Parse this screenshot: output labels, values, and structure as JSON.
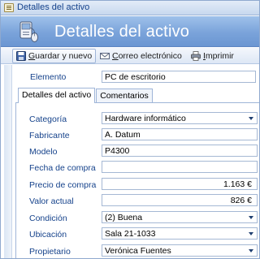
{
  "window": {
    "title": "Detalles del activo"
  },
  "header": {
    "title": "Detalles del activo",
    "icon": "computer-mouse-icon"
  },
  "toolbar": {
    "save_label": "Guardar y nuevo",
    "save_underline": "G",
    "email_label": "Correo electrónico",
    "email_underline": "C",
    "print_label": "Imprimir",
    "print_underline": "I"
  },
  "item": {
    "label": "Elemento",
    "value": "PC de escritorio"
  },
  "tabs": [
    {
      "label": "Detalles del activo",
      "active": true
    },
    {
      "label": "Comentarios",
      "active": false
    }
  ],
  "fields": {
    "categoria": {
      "label": "Categoría",
      "value": "Hardware informático"
    },
    "fabricante": {
      "label": "Fabricante",
      "value": "A. Datum"
    },
    "modelo": {
      "label": "Modelo",
      "value": "P4300"
    },
    "fecha_compra": {
      "label": "Fecha de compra",
      "value": ""
    },
    "precio_compra": {
      "label": "Precio de compra",
      "value": "1.163 €"
    },
    "valor_actual": {
      "label": "Valor actual",
      "value": "826 €"
    },
    "condicion": {
      "label": "Condición",
      "value": "(2) Buena"
    },
    "ubicacion": {
      "label": "Ubicación",
      "value": "Sala 21-1033"
    },
    "propietario": {
      "label": "Propietario",
      "value": "Verónica Fuentes"
    }
  },
  "colors": {
    "header_bg": "#7aa3da",
    "label": "#15428b",
    "field_border": "#a5b8d4"
  }
}
